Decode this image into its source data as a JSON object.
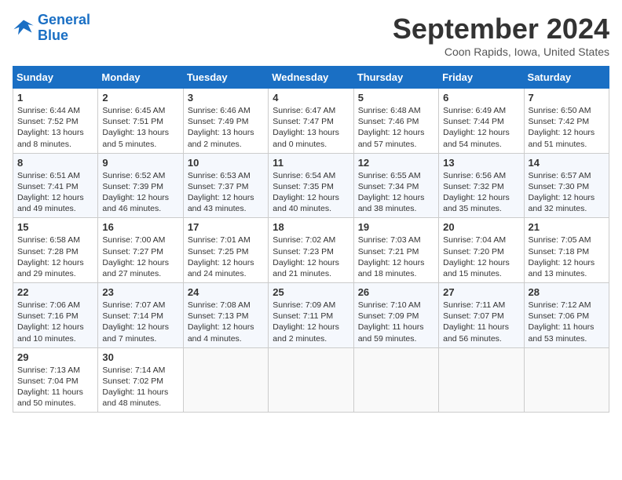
{
  "header": {
    "logo_line1": "General",
    "logo_line2": "Blue",
    "month_title": "September 2024",
    "location": "Coon Rapids, Iowa, United States"
  },
  "weekdays": [
    "Sunday",
    "Monday",
    "Tuesday",
    "Wednesday",
    "Thursday",
    "Friday",
    "Saturday"
  ],
  "weeks": [
    [
      {
        "day": "1",
        "sunrise": "6:44 AM",
        "sunset": "7:52 PM",
        "daylight": "13 hours and 8 minutes."
      },
      {
        "day": "2",
        "sunrise": "6:45 AM",
        "sunset": "7:51 PM",
        "daylight": "13 hours and 5 minutes."
      },
      {
        "day": "3",
        "sunrise": "6:46 AM",
        "sunset": "7:49 PM",
        "daylight": "13 hours and 2 minutes."
      },
      {
        "day": "4",
        "sunrise": "6:47 AM",
        "sunset": "7:47 PM",
        "daylight": "13 hours and 0 minutes."
      },
      {
        "day": "5",
        "sunrise": "6:48 AM",
        "sunset": "7:46 PM",
        "daylight": "12 hours and 57 minutes."
      },
      {
        "day": "6",
        "sunrise": "6:49 AM",
        "sunset": "7:44 PM",
        "daylight": "12 hours and 54 minutes."
      },
      {
        "day": "7",
        "sunrise": "6:50 AM",
        "sunset": "7:42 PM",
        "daylight": "12 hours and 51 minutes."
      }
    ],
    [
      {
        "day": "8",
        "sunrise": "6:51 AM",
        "sunset": "7:41 PM",
        "daylight": "12 hours and 49 minutes."
      },
      {
        "day": "9",
        "sunrise": "6:52 AM",
        "sunset": "7:39 PM",
        "daylight": "12 hours and 46 minutes."
      },
      {
        "day": "10",
        "sunrise": "6:53 AM",
        "sunset": "7:37 PM",
        "daylight": "12 hours and 43 minutes."
      },
      {
        "day": "11",
        "sunrise": "6:54 AM",
        "sunset": "7:35 PM",
        "daylight": "12 hours and 40 minutes."
      },
      {
        "day": "12",
        "sunrise": "6:55 AM",
        "sunset": "7:34 PM",
        "daylight": "12 hours and 38 minutes."
      },
      {
        "day": "13",
        "sunrise": "6:56 AM",
        "sunset": "7:32 PM",
        "daylight": "12 hours and 35 minutes."
      },
      {
        "day": "14",
        "sunrise": "6:57 AM",
        "sunset": "7:30 PM",
        "daylight": "12 hours and 32 minutes."
      }
    ],
    [
      {
        "day": "15",
        "sunrise": "6:58 AM",
        "sunset": "7:28 PM",
        "daylight": "12 hours and 29 minutes."
      },
      {
        "day": "16",
        "sunrise": "7:00 AM",
        "sunset": "7:27 PM",
        "daylight": "12 hours and 27 minutes."
      },
      {
        "day": "17",
        "sunrise": "7:01 AM",
        "sunset": "7:25 PM",
        "daylight": "12 hours and 24 minutes."
      },
      {
        "day": "18",
        "sunrise": "7:02 AM",
        "sunset": "7:23 PM",
        "daylight": "12 hours and 21 minutes."
      },
      {
        "day": "19",
        "sunrise": "7:03 AM",
        "sunset": "7:21 PM",
        "daylight": "12 hours and 18 minutes."
      },
      {
        "day": "20",
        "sunrise": "7:04 AM",
        "sunset": "7:20 PM",
        "daylight": "12 hours and 15 minutes."
      },
      {
        "day": "21",
        "sunrise": "7:05 AM",
        "sunset": "7:18 PM",
        "daylight": "12 hours and 13 minutes."
      }
    ],
    [
      {
        "day": "22",
        "sunrise": "7:06 AM",
        "sunset": "7:16 PM",
        "daylight": "12 hours and 10 minutes."
      },
      {
        "day": "23",
        "sunrise": "7:07 AM",
        "sunset": "7:14 PM",
        "daylight": "12 hours and 7 minutes."
      },
      {
        "day": "24",
        "sunrise": "7:08 AM",
        "sunset": "7:13 PM",
        "daylight": "12 hours and 4 minutes."
      },
      {
        "day": "25",
        "sunrise": "7:09 AM",
        "sunset": "7:11 PM",
        "daylight": "12 hours and 2 minutes."
      },
      {
        "day": "26",
        "sunrise": "7:10 AM",
        "sunset": "7:09 PM",
        "daylight": "11 hours and 59 minutes."
      },
      {
        "day": "27",
        "sunrise": "7:11 AM",
        "sunset": "7:07 PM",
        "daylight": "11 hours and 56 minutes."
      },
      {
        "day": "28",
        "sunrise": "7:12 AM",
        "sunset": "7:06 PM",
        "daylight": "11 hours and 53 minutes."
      }
    ],
    [
      {
        "day": "29",
        "sunrise": "7:13 AM",
        "sunset": "7:04 PM",
        "daylight": "11 hours and 50 minutes."
      },
      {
        "day": "30",
        "sunrise": "7:14 AM",
        "sunset": "7:02 PM",
        "daylight": "11 hours and 48 minutes."
      },
      null,
      null,
      null,
      null,
      null
    ]
  ]
}
